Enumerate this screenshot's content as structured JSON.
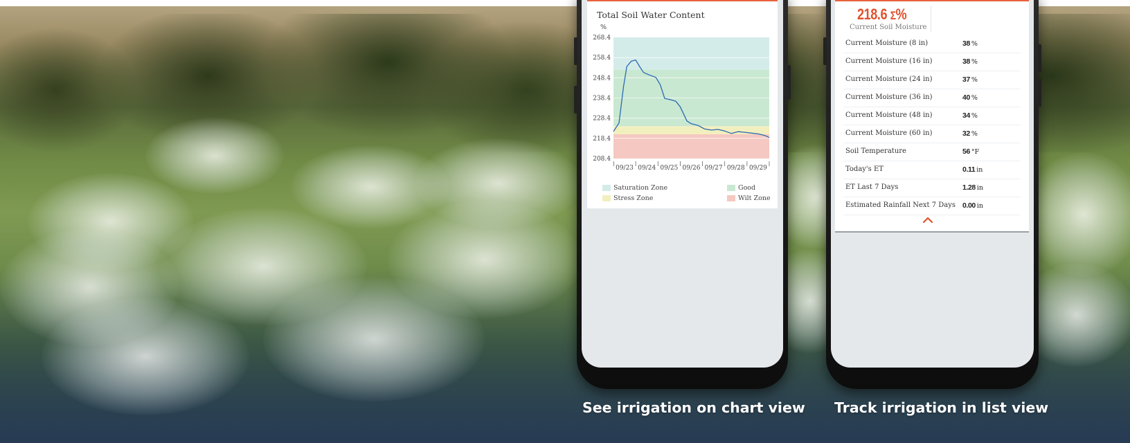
{
  "chart_card": {
    "title": "Total Soil Water Content",
    "unit": "%",
    "colors": {
      "saturation": "#d4ece9",
      "good": "#c9e8d1",
      "stress": "#f2efbf",
      "wilt": "#f5c8c1",
      "line": "#2a69b0"
    },
    "legend": [
      {
        "label": "Saturation Zone",
        "color": "#d4ece9"
      },
      {
        "label": "Good",
        "color": "#c9e8d1"
      },
      {
        "label": "Stress Zone",
        "color": "#f2efbf"
      },
      {
        "label": "Wilt Zone",
        "color": "#f5c8c1"
      }
    ]
  },
  "chart_data": {
    "type": "area",
    "title": "Total Soil Water Content",
    "ylabel": "%",
    "ylim": [
      208.4,
      268.4
    ],
    "yticks": [
      "268.4",
      "258.4",
      "248.4",
      "238.4",
      "228.4",
      "218.4",
      "208.4"
    ],
    "xticks": [
      "09/23",
      "09/24",
      "09/25",
      "09/26",
      "09/27",
      "09/28",
      "09/29"
    ],
    "xlim": [
      0,
      7
    ],
    "zones": [
      {
        "name": "Wilt Zone",
        "from": 208.4,
        "to": 220.4
      },
      {
        "name": "Stress Zone",
        "from": 220.4,
        "to": 224.4
      },
      {
        "name": "Good",
        "from": 224.4,
        "to": 252.4
      },
      {
        "name": "Saturation Zone",
        "from": 252.4,
        "to": 268.4
      }
    ],
    "series": [
      {
        "x": [
          0.0,
          0.25,
          0.45,
          0.6,
          0.8,
          1.0,
          1.2,
          1.35,
          1.6,
          1.9,
          2.1,
          2.3,
          2.6,
          2.8,
          3.0,
          3.3,
          3.5,
          3.8,
          4.1,
          4.4,
          4.7,
          5.0,
          5.3,
          5.6,
          5.9,
          6.2,
          6.5,
          6.8,
          7.0
        ],
        "y": [
          221.8,
          226.0,
          244.0,
          254.0,
          256.6,
          257.2,
          253.5,
          251.0,
          249.8,
          248.6,
          245.0,
          238.2,
          237.4,
          236.8,
          234.0,
          227.0,
          225.6,
          224.8,
          223.0,
          222.5,
          222.8,
          222.0,
          220.8,
          221.7,
          221.4,
          221.0,
          220.6,
          219.8,
          218.8
        ]
      }
    ],
    "legend": [
      "Saturation Zone",
      "Good",
      "Stress Zone",
      "Wilt Zone"
    ],
    "legend_position": "bottom"
  },
  "list_card": {
    "current_value": "218.6",
    "current_value_symbol": "Σ",
    "current_value_unit": "%",
    "current_label": "Current Soil Moisture",
    "rows": [
      {
        "label": "Current Moisture (8 in)",
        "value": "38",
        "unit": "%"
      },
      {
        "label": "Current Moisture (16 in)",
        "value": "38",
        "unit": "%"
      },
      {
        "label": "Current Moisture (24 in)",
        "value": "37",
        "unit": "%"
      },
      {
        "label": "Current Moisture (36 in)",
        "value": "40",
        "unit": "%"
      },
      {
        "label": "Current Moisture (48 in)",
        "value": "34",
        "unit": "%"
      },
      {
        "label": "Current Moisture (60 in)",
        "value": "32",
        "unit": "%"
      },
      {
        "label": "Soil Temperature",
        "value": "56",
        "unit": "°F"
      },
      {
        "label": "Today's ET",
        "value": "0.11",
        "unit": "in"
      },
      {
        "label": "ET Last 7 Days",
        "value": "1.28",
        "unit": "in"
      },
      {
        "label": "Estimated Rainfall Next 7 Days",
        "value": "0.00",
        "unit": "in"
      }
    ],
    "accent_color": "#e0512d",
    "collapse_icon": "chevron-up-icon"
  },
  "captions": {
    "chart": "See irrigation on chart view",
    "list": "Track irrigation in list view"
  }
}
